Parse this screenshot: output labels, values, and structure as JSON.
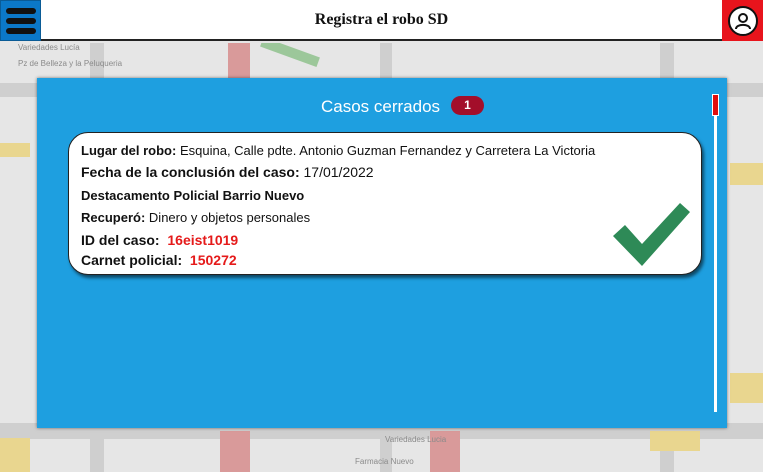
{
  "header": {
    "title": "Registra el robo SD",
    "menu_icon": "hamburger-menu-icon",
    "user_icon": "user-profile-icon"
  },
  "map": {
    "labels": [
      "Variedades Lucía",
      "Pz de Belleza y la Peluqueria",
      "Variedades Lucia",
      "Farmacia Nuevo"
    ]
  },
  "panel": {
    "title": "Casos cerrados",
    "count": "1"
  },
  "case": {
    "lugar_label": "Lugar del robo:",
    "lugar_value": "Esquina, Calle pdte. Antonio Guzman Fernandez y Carretera La Victoria",
    "fecha_label": "Fecha de la conclusión del caso:",
    "fecha_value": "17/01/2022",
    "destacamento": "Destacamento Policial Barrio Nuevo",
    "recupero_label": "Recuperó:",
    "recupero_value": "Dinero y objetos personales",
    "id_label": "ID del caso:",
    "id_value": "16eist1019",
    "carnet_label": "Carnet policial:",
    "carnet_value": "150272",
    "status_icon": "checkmark-icon"
  },
  "colors": {
    "panel_bg": "#1e9fe0",
    "menu_bg": "#0b78c8",
    "user_bg": "#e8141c",
    "badge_bg": "#a30e2a",
    "check": "#2e8a57",
    "highlight": "#e51a1a"
  }
}
